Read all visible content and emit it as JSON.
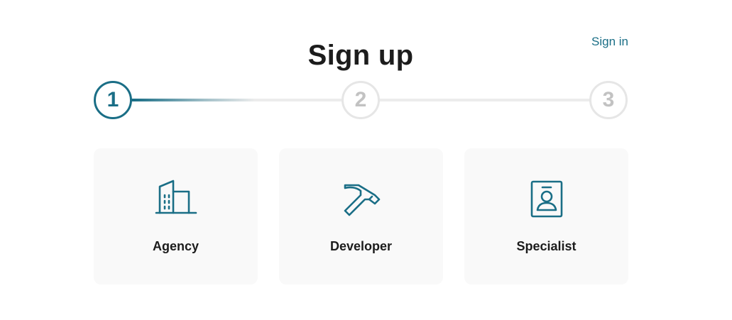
{
  "header": {
    "title": "Sign up",
    "sign_in_label": "Sign in"
  },
  "stepper": {
    "current_step": 1,
    "steps": [
      {
        "label": "1",
        "state": "active"
      },
      {
        "label": "2",
        "state": "inactive"
      },
      {
        "label": "3",
        "state": "inactive"
      }
    ]
  },
  "options": [
    {
      "label": "Agency",
      "icon": "building-icon"
    },
    {
      "label": "Developer",
      "icon": "hammer-icon"
    },
    {
      "label": "Specialist",
      "icon": "id-badge-icon"
    }
  ],
  "colors": {
    "accent": "#1a6e86",
    "inactive_step": "#c2c2c2",
    "card_background": "#f9f9f9",
    "track": "#ececec"
  }
}
